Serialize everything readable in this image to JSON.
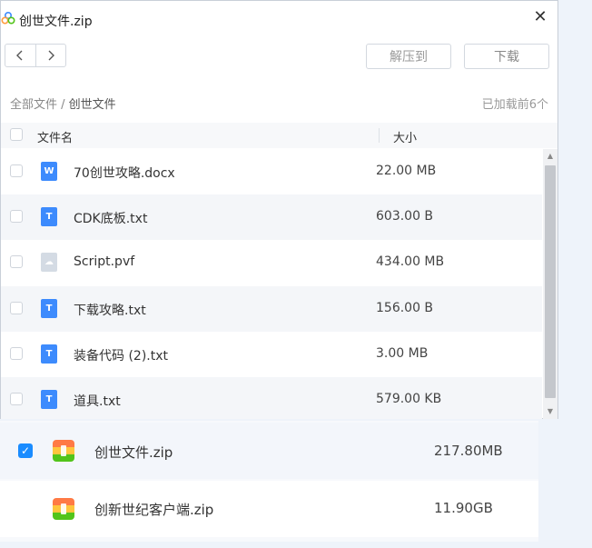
{
  "background_list": {
    "items": [
      {
        "name": "创世文件.zip",
        "size": "217.80MB",
        "checked": true
      },
      {
        "name": "创新世纪客户端.zip",
        "size": "11.90GB",
        "checked": false
      }
    ]
  },
  "window": {
    "title": "创世文件.zip",
    "close_glyph": "✕",
    "toolbar": {
      "back_glyph": "‹",
      "forward_glyph": "›",
      "extract_label": "解压到",
      "download_label": "下载"
    },
    "breadcrumb": {
      "root": "全部文件",
      "separator": " / ",
      "current": "创世文件"
    },
    "loaded_text": "已加载前6个",
    "columns": {
      "name": "文件名",
      "size": "大小"
    },
    "files": [
      {
        "name": "70创世攻略.docx",
        "size": "22.00 MB",
        "icon": "word-doc-icon",
        "badge": "W"
      },
      {
        "name": "CDK底板.txt",
        "size": "603.00 B",
        "icon": "text-file-icon",
        "badge": "T"
      },
      {
        "name": "Script.pvf",
        "size": "434.00 MB",
        "icon": "generic-file-icon",
        "badge": "☁"
      },
      {
        "name": "下载攻略.txt",
        "size": "156.00 B",
        "icon": "text-file-icon",
        "badge": "T"
      },
      {
        "name": "装备代码 (2).txt",
        "size": "3.00 MB",
        "icon": "text-file-icon",
        "badge": "T"
      },
      {
        "name": "道具.txt",
        "size": "579.00 KB",
        "icon": "text-file-icon",
        "badge": "T"
      }
    ]
  },
  "colors": {
    "accent": "#1a8cff",
    "file_blue": "#3d8bfd"
  }
}
